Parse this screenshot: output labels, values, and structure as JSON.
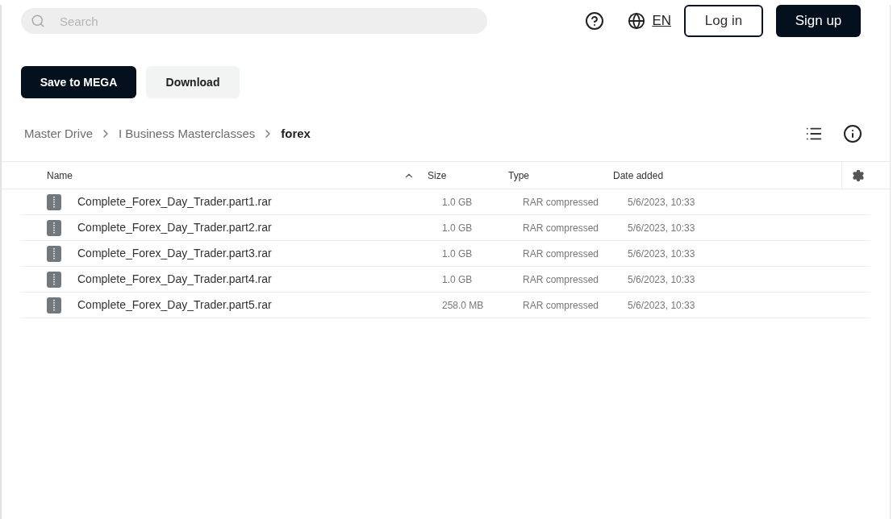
{
  "search": {
    "placeholder": "Search"
  },
  "language": "EN",
  "auth_buttons": [
    "Log in",
    "Sign up"
  ],
  "actions": [
    "Save to MEGA",
    "Download"
  ],
  "breadcrumb": [
    {
      "label": "Master Drive",
      "selected": false
    },
    {
      "label": "I Business Masterclasses",
      "selected": false
    },
    {
      "label": "forex",
      "selected": true
    }
  ],
  "table": {
    "columns": [
      "Name",
      "Size",
      "Type",
      "Date added"
    ],
    "rows": [
      {
        "name": "Complete_Forex_Day_Trader.part1.rar",
        "size": "1.0 GB",
        "type": "RAR compressed",
        "date": "5/6/2023, 10:33"
      },
      {
        "name": "Complete_Forex_Day_Trader.part2.rar",
        "size": "1.0 GB",
        "type": "RAR compressed",
        "date": "5/6/2023, 10:33"
      },
      {
        "name": "Complete_Forex_Day_Trader.part3.rar",
        "size": "1.0 GB",
        "type": "RAR compressed",
        "date": "5/6/2023, 10:33"
      },
      {
        "name": "Complete_Forex_Day_Trader.part4.rar",
        "size": "1.0 GB",
        "type": "RAR compressed",
        "date": "5/6/2023, 10:33"
      },
      {
        "name": "Complete_Forex_Day_Trader.part5.rar",
        "size": "258.0 MB",
        "type": "RAR compressed",
        "date": "5/6/2023, 10:33"
      }
    ]
  }
}
